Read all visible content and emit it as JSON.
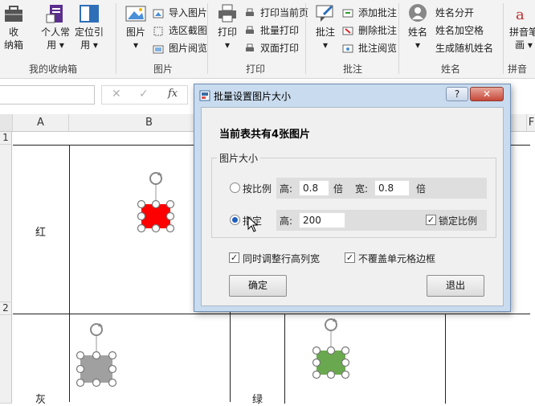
{
  "ribbon": {
    "box": {
      "line1": "收",
      "line2": "纳箱"
    },
    "custom": {
      "line1": "个人常",
      "line2": "用 ▾"
    },
    "locate": {
      "line1": "定位引",
      "line2": "用 ▾"
    },
    "group_mybox": "我的收纳箱",
    "picture": {
      "line1": "图片",
      "line2": "▾"
    },
    "import_pic": "导入图片",
    "crop_pic": "选区截图",
    "browse_pic": "图片阅览",
    "group_picture": "图片",
    "print": {
      "line1": "打印",
      "line2": "▾"
    },
    "print_current": "打印当前页",
    "batch_print": "批量打印",
    "duplex_print": "双面打印",
    "group_print": "打印",
    "comment": {
      "line1": "批注",
      "line2": "▾"
    },
    "add_comment": "添加批注",
    "delete_comment": "删除批注",
    "browse_comment": "批注阅览",
    "group_comment": "批注",
    "name": {
      "line1": "姓名",
      "line2": "▾"
    },
    "split_name": "姓名分开",
    "space_name": "姓名加空格",
    "random_name": "生成随机姓名",
    "group_name": "姓名",
    "pinyin": {
      "line1": "拼音笔",
      "line2": "画 ▾"
    },
    "group_pinyin": "拼音"
  },
  "formula_bar": {
    "cancel": "✕",
    "enter": "✓",
    "fx": "fx"
  },
  "grid": {
    "columns": [
      "A",
      "B",
      "F"
    ],
    "rows": [
      "1",
      "2"
    ],
    "cells": {
      "a1": "红",
      "a2": "灰",
      "b2": "绿"
    }
  },
  "dialog": {
    "title": "批量设置图片大小",
    "help": "?",
    "close": "✕",
    "info": "当前表共有4张图片",
    "group_label": "图片大小",
    "by_ratio": "按比例",
    "height_label": "高:",
    "ratio_height": "0.8",
    "times1": "倍",
    "width_label": "宽:",
    "ratio_width": "0.8",
    "times2": "倍",
    "specify": "指定",
    "height_label2": "高:",
    "specify_height": "200",
    "lock_ratio": "锁定比例",
    "adjust_row_col": "同时调整行高列宽",
    "no_cover_border": "不覆盖单元格边框",
    "ok": "确定",
    "exit": "退出"
  },
  "colors": {
    "red_shape": "#ff0000",
    "gray_shape": "#a0a0a0",
    "green_shape": "#6aa84f"
  }
}
